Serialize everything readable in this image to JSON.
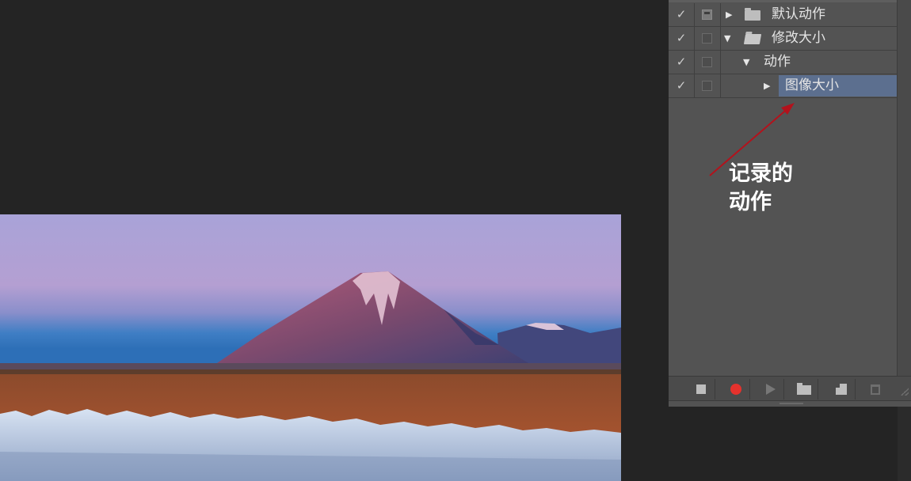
{
  "actions_panel": {
    "rows": [
      {
        "checked": "✓",
        "dialog": "filled",
        "expand": "▶",
        "icon": "folder-icon",
        "label": "默认动作"
      },
      {
        "checked": "✓",
        "dialog": "empty",
        "expand": "▼",
        "icon": "folder-open-icon",
        "label": "修改大小"
      },
      {
        "checked": "✓",
        "dialog": "empty",
        "expand": "▼",
        "icon": "",
        "label": "动作"
      },
      {
        "checked": "✓",
        "dialog": "empty",
        "expand": "▶",
        "icon": "",
        "label": "图像大小",
        "selected": true
      }
    ],
    "toolbar": [
      "stop-icon",
      "record-icon",
      "play-icon",
      "new-set-icon",
      "new-action-icon",
      "trash-icon"
    ]
  },
  "annotation": {
    "text": "记录的\n动作"
  },
  "colors": {
    "record": "#e5322d",
    "selection": "#5c6f8f",
    "panel_bg": "#535353",
    "workspace_bg": "#242424",
    "arrow": "#b3121c"
  }
}
